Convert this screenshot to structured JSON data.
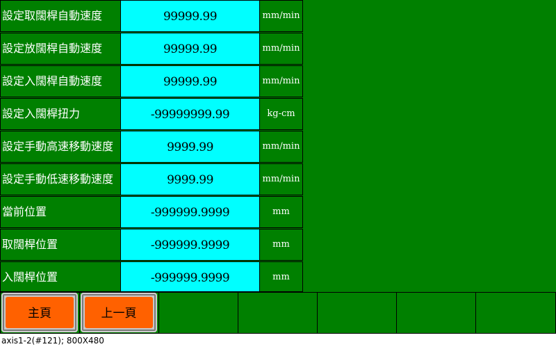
{
  "rows": [
    {
      "label": "設定取闊桿自動速度",
      "value": "99999.99",
      "unit": "mm/min"
    },
    {
      "label": "設定放闊桿自動速度",
      "value": "99999.99",
      "unit": "mm/min"
    },
    {
      "label": "設定入闊桿自動速度",
      "value": "99999.99",
      "unit": "mm/min"
    },
    {
      "label": "設定入闊桿扭力",
      "value": "-99999999.99",
      "unit": "kg-cm"
    },
    {
      "label": "設定手動高速移動速度",
      "value": "9999.99",
      "unit": "mm/min"
    },
    {
      "label": "設定手動低速移動速度",
      "value": "9999.99",
      "unit": "mm/min"
    },
    {
      "label": "當前位置",
      "value": "-999999.9999",
      "unit": "mm"
    },
    {
      "label": "取闊桿位置",
      "value": "-999999.9999",
      "unit": "mm"
    },
    {
      "label": "入闊桿位置",
      "value": "-999999.9999",
      "unit": "mm"
    }
  ],
  "buttons": {
    "home_label": "主頁",
    "back_label": "上一頁"
  },
  "status": "axis1-2(#121); 800X480",
  "colors": {
    "background": "#008000",
    "value_field": "#00ffff",
    "button": "#ff6100"
  }
}
